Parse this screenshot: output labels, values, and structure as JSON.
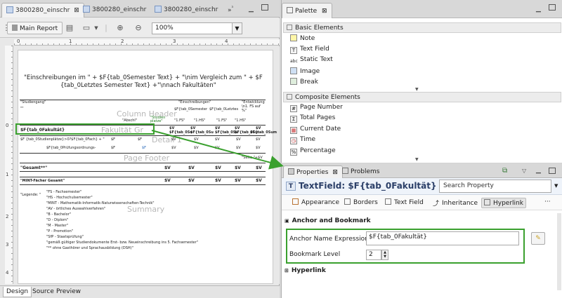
{
  "editor": {
    "tabs": [
      {
        "label": "3800280_einschr",
        "active": true,
        "close": "⊠"
      },
      {
        "label": "3800280_einschr",
        "active": false
      },
      {
        "label": "3800280_einschr",
        "active": false
      },
      {
        "label": "»",
        "active": false
      },
      {
        "label": "³",
        "active": false
      }
    ],
    "toolbar": {
      "main_report": "Main Report",
      "zoom": "100%"
    },
    "ruler_marks": {
      "top": [
        "0",
        "1",
        "2",
        "3",
        "4"
      ],
      "left": [
        "0",
        "1",
        "2",
        "3",
        "4"
      ]
    },
    "bottom_tabs": [
      "Design",
      "Source",
      "Preview"
    ]
  },
  "report": {
    "title_line1": "\"Einschreibungen im \" + $F{tab_0Semester Text} + \"\\nim Vergleich zum \" + $F",
    "title_line2": "{tab_0Letztes Semester Text} +\"\\nnach Fakultäten\"",
    "col_studiengang": "\"Studiengang\"",
    "col_einschreibungen": "\"Einschreibungen\"",
    "col_entwicklung": "\"Entwicklung \\n1. FS auf %\"",
    "col_sem1": "$F{tab_0Semester",
    "col_sem2": "$F{tab_0Letztes",
    "col_abschl": "\"Abschl\"",
    "col_studien": "\"Studien platze\"",
    "col_1fs_a": "\"1.FS\"",
    "col_1hs_a": "\"1.HS\"",
    "col_1fs_b": "\"1.FS\"",
    "col_1hs_b": "\"1.HS\"",
    "dots": "\"\"",
    "wm_column_header": "Column Header",
    "wm_fakultat_group": "Fakultät Gr",
    "wm_detail": "Detail 1",
    "wm_page_footer": "Page Footer",
    "wm_summary": "Summary",
    "field_fakultat": "$F{tab_0Fakultät}",
    "field_tab0su": "$F{tab_0Su",
    "field_tab0sum": "$F{tab_0Sum",
    "field_studienplatze": "$F {tab_0Studienplätze}>0?$F{tab_0Fach} + \"",
    "field_v": "$V",
    "field_f": "$F",
    "field_pruefung": "$F{tab_0Prüfungsordnungs-",
    "page_footer_text": "\"Seite \"+$V",
    "gesamt": "\"Gesamt**\"",
    "mint": "\"MINT-Fächer Gesamt\"",
    "legend_label": "\"Legende: \"",
    "legend": [
      "\"FS - Fachsemester\"",
      "\"HS - Hochschulsemester\"",
      "\"MINT - Mathematik-Informatik-Naturwissenschaften-Technik\"",
      "\"AV - örtliches Auswahlverfahren\"",
      "\"B - Bachelor\"",
      "\"D - Diplom\"",
      "\"M - Master\"",
      "\"P - Promotion\"",
      "\"SfP - Staatsprüfung\"",
      "\"gemäß gültiger Studiendokumente Erst- bzw. Neueinschreibung ins 5. Fachsemester\"",
      "\"** ohne Gasthörer und Sprachausbildung (DSH)\""
    ]
  },
  "palette": {
    "title": "Palette",
    "close": "⊠",
    "basic_title": "Basic Elements",
    "basic_items": [
      {
        "label": "Note",
        "icon": "note-icon"
      },
      {
        "label": "Text Field",
        "icon": "text-field-icon"
      },
      {
        "label": "Static Text",
        "icon": "static-text-icon"
      },
      {
        "label": "Image",
        "icon": "image-icon"
      },
      {
        "label": "Break",
        "icon": "break-icon"
      }
    ],
    "composite_title": "Composite Elements",
    "composite_items": [
      {
        "label": "Page Number",
        "icon": "hash-icon",
        "glyph": "#"
      },
      {
        "label": "Total Pages",
        "icon": "sigma-icon",
        "glyph": "Σ"
      },
      {
        "label": "Current Date",
        "icon": "calendar-icon",
        "glyph": "▦"
      },
      {
        "label": "Time",
        "icon": "clock-icon",
        "glyph": "◷"
      },
      {
        "label": "Percentage",
        "icon": "percent-icon",
        "glyph": "%"
      }
    ]
  },
  "properties": {
    "tab_properties": "Properties",
    "tab_problems": "Problems",
    "heading": "TextField: $F{tab_0Fakultät}",
    "search_placeholder": "Search Property",
    "subtabs": [
      "Appearance",
      "Borders",
      "Text Field",
      "Inheritance",
      "Hyperlink"
    ],
    "more": "···",
    "section_anchor": "Anchor and Bookmark",
    "anchor_label": "Anchor Name Expression",
    "anchor_value": "$F{tab_0Fakultät}",
    "bookmark_label": "Bookmark Level",
    "bookmark_value": "2",
    "section_hyperlink": "Hyperlink"
  },
  "colors": {
    "highlight_green": "#3aa02e",
    "heading_blue": "#2b3f68"
  }
}
